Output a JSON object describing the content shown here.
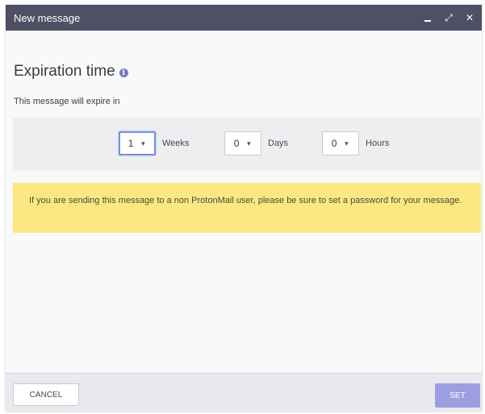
{
  "window": {
    "title": "New message",
    "controls": {
      "minimize_icon": "minimize-icon",
      "expand_icon": "expand-icon",
      "close_icon": "close-icon",
      "expand_glyph": "⤢",
      "close_glyph": "✕"
    }
  },
  "expiration": {
    "heading": "Expiration time",
    "info_glyph": "i",
    "subtext": "This message will expire in",
    "fields": [
      {
        "value": "1",
        "unit": "Weeks"
      },
      {
        "value": "0",
        "unit": "Days"
      },
      {
        "value": "0",
        "unit": "Hours"
      }
    ]
  },
  "notice": {
    "text": "If you are sending this message to a non ProtonMail user, please be sure to set a password for your message."
  },
  "footer": {
    "cancel_label": "CANCEL",
    "set_label": "SET"
  },
  "colors": {
    "titlebar": "#4f5066",
    "notice_bg": "#fbe883",
    "set_button": "#9c9ee0",
    "focus_border": "#7093d8"
  }
}
